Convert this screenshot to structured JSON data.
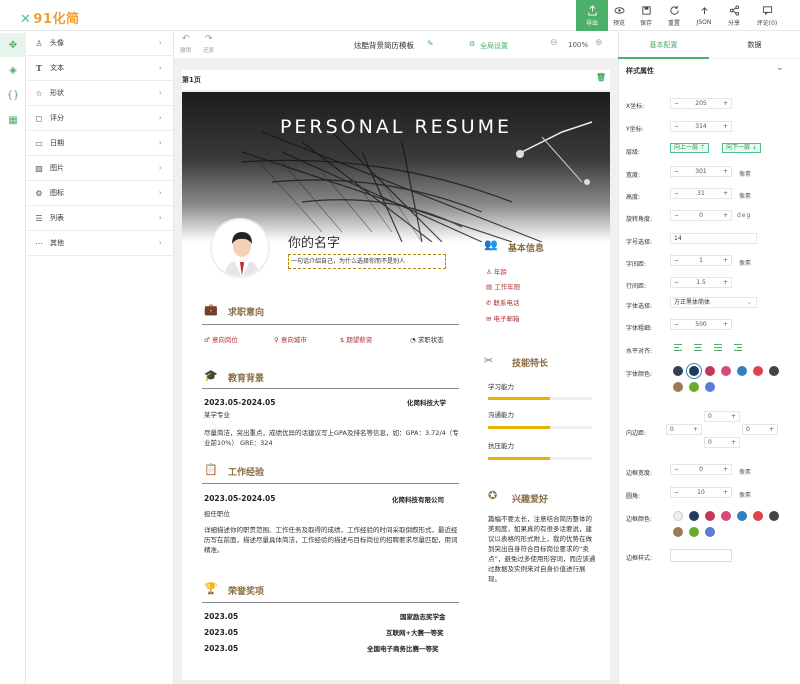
{
  "app": {
    "logo": "91化简"
  },
  "toolbar": {
    "export": "导出",
    "preview": "预览",
    "save": "保存",
    "reset": "重置",
    "json": "JSON",
    "share": "分享",
    "comment": "评论(0)"
  },
  "sidebar": {
    "items": [
      {
        "label": "头像",
        "icon": "person-icon"
      },
      {
        "label": "文本",
        "icon": "text-icon"
      },
      {
        "label": "形状",
        "icon": "star-icon"
      },
      {
        "label": "评分",
        "icon": "rating-icon"
      },
      {
        "label": "日期",
        "icon": "calendar-icon"
      },
      {
        "label": "图片",
        "icon": "image-icon"
      },
      {
        "label": "图标",
        "icon": "grid-icon"
      },
      {
        "label": "列表",
        "icon": "list-icon"
      },
      {
        "label": "其他",
        "icon": "more-icon"
      }
    ]
  },
  "canvas_toolbar": {
    "undo": "撤销",
    "redo": "还原",
    "template_name": "炫酷背景简历模板",
    "global_settings": "全局设置",
    "zoom": "100%"
  },
  "page": {
    "label": "第1页"
  },
  "resume": {
    "title": "PERSONAL RESUME",
    "name": "你的名字",
    "motto": "一句话介绍自己，为什么选择你而不是别人",
    "job_intent": {
      "heading": "求职意向",
      "items": [
        "意向岗位",
        "意向城市",
        "期望薪资",
        "求职状态"
      ]
    },
    "education": {
      "heading": "教育背景",
      "date": "2023.05-2024.05",
      "school": "化简科技大学",
      "major": "某学专业",
      "desc": "尽量简洁，突出重点，成绩优异的话建议写上GPA及排名等信息，如：GPA：3.72/4（专业前10%） GRE：324"
    },
    "work": {
      "heading": "工作经验",
      "date": "2023.05-2024.05",
      "company": "化简科技有限公司",
      "role": "担任职位",
      "desc": "详细描述你的职责范围、工作任务及取得的成绩，工作经验的时间采取倒叙形式，最近经历写在前面，描述尽量具体简洁，工作经验的描述与目标岗位的招聘要求尽量匹配，用词精准。"
    },
    "awards": {
      "heading": "荣誉奖项",
      "items": [
        {
          "date": "2023.05",
          "name": "国家励志奖学金"
        },
        {
          "date": "2023.05",
          "name": "互联网+大赛一等奖"
        },
        {
          "date": "2023.05",
          "name": "全国电子商务比赛一等奖"
        }
      ]
    },
    "basic_info": {
      "heading": "基本信息",
      "items": [
        "年龄",
        "工作年限",
        "联系电话",
        "电子邮箱"
      ]
    },
    "skills": {
      "heading": "技能特长",
      "items": [
        {
          "name": "学习能力",
          "level": 0.6
        },
        {
          "name": "沟通能力",
          "level": 0.6
        },
        {
          "name": "抗压能力",
          "level": 0.6
        }
      ]
    },
    "hobbies": {
      "heading": "兴趣爱好",
      "desc": "篇幅不要太长，注意结合简历整体的美观度，如果真的有很多话要说，建议以表格的形式附上，我的优势在做到突出自身符合目标岗位要求的“卖点”，避免过多使用形容词，而应该通过数据及实例来对自身价值进行展现。"
    }
  },
  "right_panel": {
    "tabs": [
      "基本配置",
      "数据"
    ],
    "section": "样式属性",
    "fields": {
      "x_label": "X坐标:",
      "x": "205",
      "y_label": "Y坐标:",
      "y": "314",
      "layer_label": "层级:",
      "layer_up": "向上一层",
      "layer_down": "向下一层",
      "width_label": "宽度:",
      "width": "301",
      "width_unit": "像素",
      "height_label": "高度:",
      "height": "31",
      "height_unit": "像素",
      "rotate_label": "旋转角度:",
      "rotate": "0",
      "rotate_unit": "deg",
      "fontsize_label": "字号选择:",
      "fontsize": "14",
      "letter_label": "字间距:",
      "letter": "1",
      "letter_unit": "像素",
      "line_label": "行间距:",
      "line": "1.5",
      "font_label": "字体选择:",
      "font": "方正黑体简体",
      "weight_label": "字体粗细:",
      "weight": "500",
      "align_label": "水平对齐:",
      "color_label": "字体颜色:",
      "padding_label": "内边距:",
      "padding": [
        "0",
        "0",
        "0",
        "0"
      ],
      "border_width_label": "边框宽度:",
      "border_width": "0",
      "border_width_unit": "像素",
      "radius_label": "圆角:",
      "radius": "10",
      "radius_unit": "像素",
      "border_color_label": "边框颜色:",
      "border_style_label": "边框样式:"
    },
    "font_colors": [
      "#334155",
      "#1e3a5f",
      "#c0395a",
      "#d64a7a",
      "#2f80c0",
      "#e0444a",
      "#444444",
      "#9b7b56",
      "#6aab2a",
      "#5a7bd6"
    ],
    "border_colors": [
      "#eeeeee",
      "#1e3a5f",
      "#c0395a",
      "#d64a7a",
      "#2f80c0",
      "#e0444a",
      "#444444",
      "#9b7b56",
      "#6aab2a",
      "#5a7bd6"
    ]
  },
  "colors": {
    "accent": "#4caf6a",
    "resume_accent": "#8a6d45",
    "highlight": "#b03030"
  }
}
